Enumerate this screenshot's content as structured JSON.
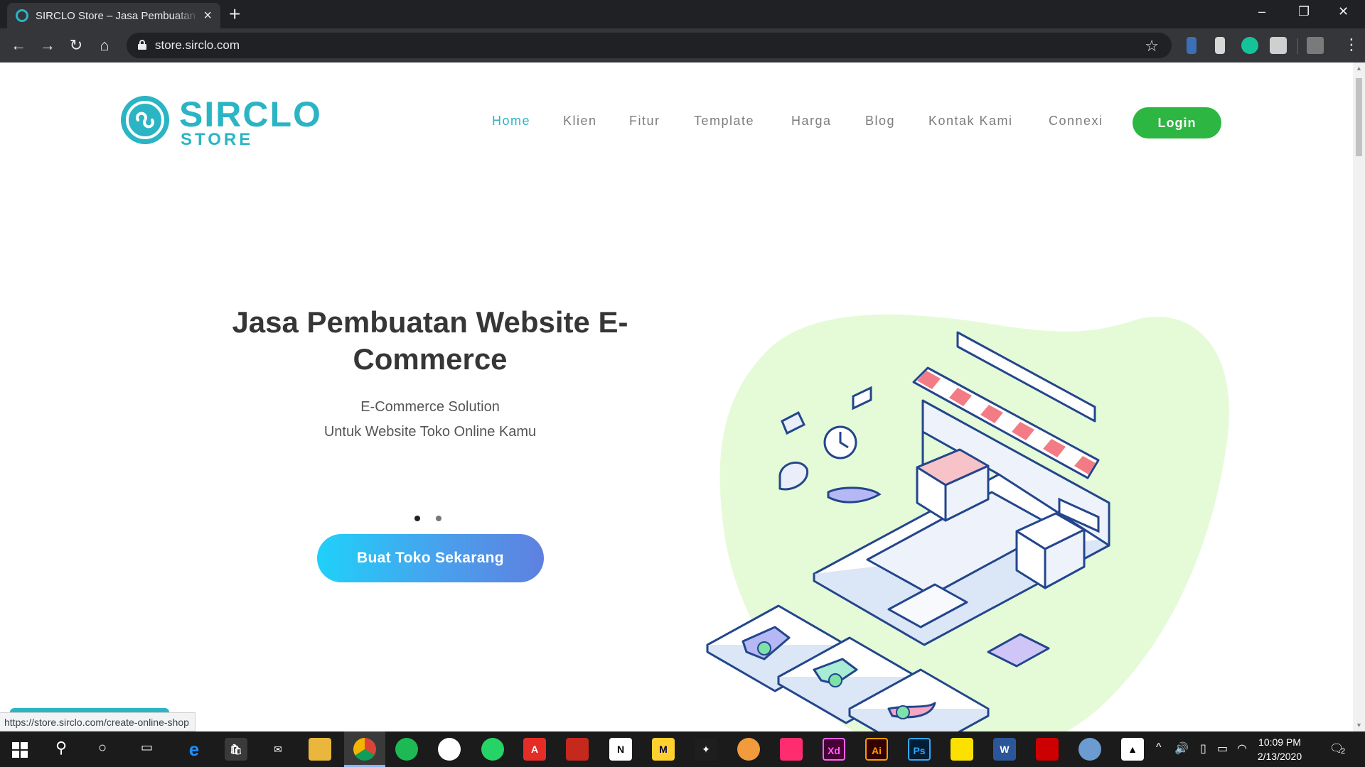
{
  "browser": {
    "tab_title": "SIRCLO Store – Jasa Pembuatan Website",
    "new_tab": "+",
    "url": "store.sirclo.com",
    "status_url": "https://store.sirclo.com/create-online-shop",
    "colors": {
      "frame": "#202124",
      "toolbar": "#35363a"
    }
  },
  "site": {
    "logo": {
      "word": "SIRCLO",
      "sub": "STORE"
    },
    "nav": [
      "Home",
      "Klien",
      "Fitur",
      "Template",
      "Harga",
      "Blog",
      "Kontak Kami",
      "Connexi"
    ],
    "nav_active": "Home",
    "login_label": "Login",
    "hero": {
      "title": "Jasa Pembuatan Website E-Commerce",
      "subtitle_line1": "E-Commerce Solution",
      "subtitle_line2": "Untuk Website Toko Online Kamu",
      "cta_label": "Buat Toko Sekarang",
      "slides": 2,
      "active_slide": 1
    },
    "colors": {
      "brand": "#2bb5c4",
      "login": "#2db742",
      "cta_start": "#1fd1f9",
      "cta_end": "#5f80e0",
      "blob": "#e5fbd8"
    }
  },
  "taskbar": {
    "apps": [
      "start-icon",
      "search-icon",
      "cortana-icon",
      "task-view-icon",
      "edge-icon",
      "store-icon",
      "mail-icon",
      "file-explorer-icon",
      "chrome-icon",
      "spotify-icon",
      "slack-icon",
      "whatsapp-icon",
      "acrobat-icon",
      "sketchup-icon",
      "notion-icon",
      "miro-icon",
      "figma-icon",
      "paint3d-icon",
      "app-icon",
      "xd-icon",
      "illustrator-icon",
      "photoshop-icon",
      "sticky-notes-icon",
      "word-icon",
      "pdf-icon",
      "paint-icon",
      "photos-icon"
    ],
    "xd_label": "Xd",
    "ai_label": "Ai",
    "ps_label": "Ps",
    "time": "10:09 PM",
    "date": "2/13/2020",
    "notif_count": "2"
  }
}
